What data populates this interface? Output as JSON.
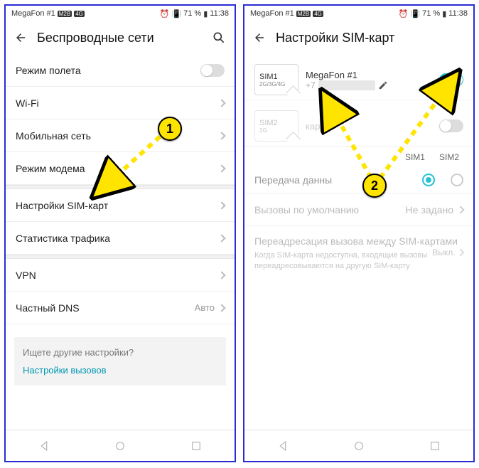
{
  "status": {
    "carrier": "MegaFon #1",
    "badge1": "M2B",
    "badge2": "4G",
    "alarm_icon": "alarm",
    "vibrate_icon": "vibrate",
    "battery_text": "71 %",
    "time": "11:38"
  },
  "left": {
    "title": "Беспроводные сети",
    "rows": {
      "airplane": "Режим полета",
      "wifi": "Wi-Fi",
      "mobile": "Мобильная сеть",
      "tether": "Режим модема",
      "sim": "Настройки SIM-карт",
      "traffic": "Статистика трафика",
      "vpn": "VPN",
      "dns": "Частный DNS",
      "dns_val": "Авто"
    },
    "hint_q": "Ищете другие настройки?",
    "hint_link": "Настройки вызовов"
  },
  "right": {
    "title": "Настройки SIM-карт",
    "sim1": {
      "slot": "SIM1",
      "bands": "2G/3G/4G",
      "name": "MegaFon #1",
      "phone_prefix": "+7"
    },
    "sim2": {
      "slot": "SIM2",
      "bands": "2G",
      "name_hint": "карты"
    },
    "col1": "SIM1",
    "col2": "SIM2",
    "data_label": "Передача данны",
    "calls_label": "Вызовы по умолчанию",
    "calls_val": "Не задано",
    "fwd_title": "Переадресация вызова между SIM-картами",
    "fwd_sub": "Когда SIM-карта недоступна, входящие вызовы переадресовываются на другую SIM-карту",
    "fwd_val": "Выкл."
  },
  "annotations": {
    "b1": "1",
    "b2": "2"
  }
}
